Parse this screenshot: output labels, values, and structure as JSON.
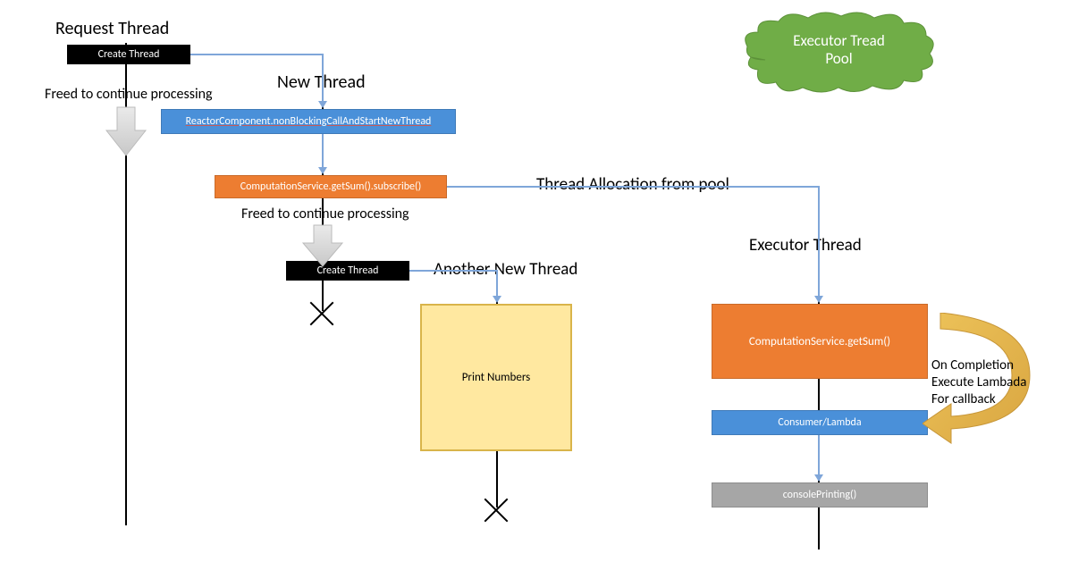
{
  "labels": {
    "request_thread": "Request Thread",
    "new_thread": "New Thread",
    "another_new_thread": "Another New Thread",
    "executor_thread": "Executor Thread",
    "thread_allocation": "Thread Allocation from pool",
    "freed1": "Freed to continue processing",
    "freed2": "Freed to continue processing"
  },
  "boxes": {
    "create_thread_1": "Create Thread",
    "create_thread_2": "Create Thread",
    "reactor_component": "ReactorComponent.nonBlockingCallAndStartNewThread",
    "computation_subscribe": "ComputationService.getSum().subscribe()",
    "print_numbers": "Print Numbers",
    "computation_getsum": "ComputationService.getSum()",
    "consumer_lambda": "Consumer/Lambda",
    "console_printing": "consolePrinting()"
  },
  "cloud": {
    "line1": "Executor Tread",
    "line2": "Pool"
  },
  "notes": {
    "on_completion": "On Completion\nExecute Lambada\nFor callback"
  }
}
